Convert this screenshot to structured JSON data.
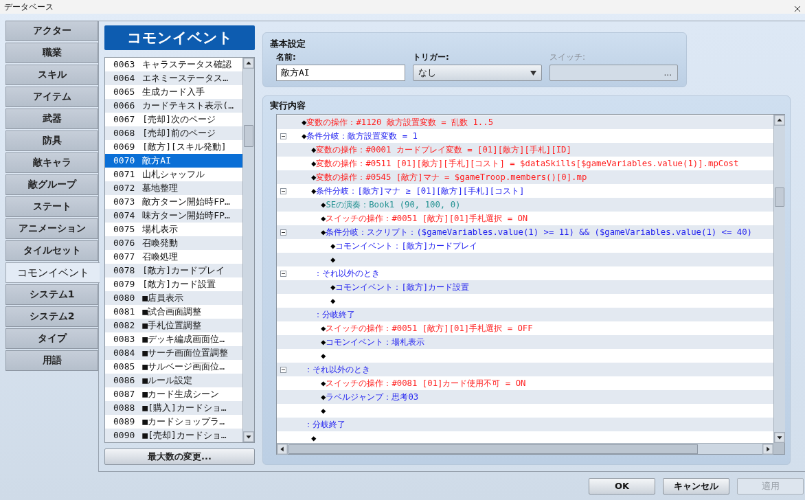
{
  "window": {
    "title": "データベース"
  },
  "tabs": [
    {
      "label": "アクター",
      "selected": false
    },
    {
      "label": "職業",
      "selected": false
    },
    {
      "label": "スキル",
      "selected": false
    },
    {
      "label": "アイテム",
      "selected": false
    },
    {
      "label": "武器",
      "selected": false
    },
    {
      "label": "防具",
      "selected": false
    },
    {
      "label": "敵キャラ",
      "selected": false
    },
    {
      "label": "敵グループ",
      "selected": false
    },
    {
      "label": "ステート",
      "selected": false
    },
    {
      "label": "アニメーション",
      "selected": false
    },
    {
      "label": "タイルセット",
      "selected": false
    },
    {
      "label": "コモンイベント",
      "selected": true
    },
    {
      "label": "システム1",
      "selected": false
    },
    {
      "label": "システム2",
      "selected": false
    },
    {
      "label": "タイプ",
      "selected": false
    },
    {
      "label": "用語",
      "selected": false
    }
  ],
  "event_list": {
    "title": "コモンイベント",
    "items": [
      {
        "number": "0063",
        "name": "キャラステータス確認",
        "selected": false
      },
      {
        "number": "0064",
        "name": "エネミーステータス…",
        "selected": false
      },
      {
        "number": "0065",
        "name": "生成カード入手",
        "selected": false
      },
      {
        "number": "0066",
        "name": "カードテキスト表示(…",
        "selected": false
      },
      {
        "number": "0067",
        "name": "[売却]次のページ",
        "selected": false
      },
      {
        "number": "0068",
        "name": "[売却]前のページ",
        "selected": false
      },
      {
        "number": "0069",
        "name": "[敵方][スキル発動]",
        "selected": false
      },
      {
        "number": "0070",
        "name": "敵方AI",
        "selected": true
      },
      {
        "number": "0071",
        "name": "山札シャッフル",
        "selected": false
      },
      {
        "number": "0072",
        "name": "墓地整理",
        "selected": false
      },
      {
        "number": "0073",
        "name": "敵方ターン開始時FP…",
        "selected": false
      },
      {
        "number": "0074",
        "name": "味方ターン開始時FP…",
        "selected": false
      },
      {
        "number": "0075",
        "name": "場札表示",
        "selected": false
      },
      {
        "number": "0076",
        "name": "召喚発動",
        "selected": false
      },
      {
        "number": "0077",
        "name": "召喚処理",
        "selected": false
      },
      {
        "number": "0078",
        "name": "[敵方]カードプレイ",
        "selected": false
      },
      {
        "number": "0079",
        "name": "[敵方]カード設置",
        "selected": false
      },
      {
        "number": "0080",
        "name": "■店員表示",
        "selected": false
      },
      {
        "number": "0081",
        "name": "■試合画面調整",
        "selected": false
      },
      {
        "number": "0082",
        "name": "■手札位置調整",
        "selected": false
      },
      {
        "number": "0083",
        "name": "■デッキ編成画面位…",
        "selected": false
      },
      {
        "number": "0084",
        "name": "■サーチ画面位置調整",
        "selected": false
      },
      {
        "number": "0085",
        "name": "■サルベージ画面位…",
        "selected": false
      },
      {
        "number": "0086",
        "name": "■ルール設定",
        "selected": false
      },
      {
        "number": "0087",
        "name": "■カード生成シーン",
        "selected": false
      },
      {
        "number": "0088",
        "name": "■[購入]カードショ…",
        "selected": false
      },
      {
        "number": "0089",
        "name": "■カードショップラ…",
        "selected": false
      },
      {
        "number": "0090",
        "name": "■[売却]カードショ…",
        "selected": false
      }
    ],
    "max_button": "最大数の変更..."
  },
  "basic_settings": {
    "title": "基本設定",
    "name_label": "名前:",
    "name_value": "敵方AI",
    "trigger_label": "トリガー:",
    "trigger_value": "なし",
    "switch_label": "スイッチ:",
    "switch_button": "...",
    "switch_disabled": true
  },
  "contents": {
    "title": "実行内容",
    "commands": [
      {
        "kind": "operation",
        "marker": "◆",
        "text": "変数の操作：#1120 敵方設置変数 = 乱数 1..5"
      },
      {
        "kind": "flow",
        "marker": "◆",
        "text": "条件分岐：敵方設置変数 = 1",
        "expanded": true,
        "children": [
          {
            "kind": "operation",
            "marker": "◆",
            "text": "変数の操作：#0001 カードプレイ変数 = [01][敵方][手札][ID]"
          },
          {
            "kind": "operation",
            "marker": "◆",
            "text": "変数の操作：#0511 [01][敵方][手札][コスト] = $dataSkills[$gameVariables.value(1)].mpCost"
          },
          {
            "kind": "operation",
            "marker": "◆",
            "text": "変数の操作：#0545 [敵方]マナ = $gameTroop.members()[0].mp"
          },
          {
            "kind": "flow",
            "marker": "◆",
            "text": "条件分岐：[敵方]マナ ≥ [01][敵方][手札][コスト]",
            "expanded": true,
            "children": [
              {
                "kind": "audio",
                "marker": "◆",
                "text": "SEの演奏：Book1 (90, 100, 0)"
              },
              {
                "kind": "operation",
                "marker": "◆",
                "text": "スイッチの操作：#0051 [敵方][01]手札選択 = ON"
              },
              {
                "kind": "flow",
                "marker": "◆",
                "text": "条件分岐：スクリプト：($gameVariables.value(1) >= 11) && ($gameVariables.value(1) <= 40)",
                "expanded": true,
                "children": [
                  {
                    "kind": "flow",
                    "marker": "◆",
                    "text": "コモンイベント：[敵方]カードプレイ"
                  },
                  {
                    "kind": "empty",
                    "marker": "◆"
                  }
                ]
              },
              {
                "kind": "branch",
                "text": "：それ以外のとき",
                "expanded": true,
                "children": [
                  {
                    "kind": "flow",
                    "marker": "◆",
                    "text": "コモンイベント：[敵方]カード設置"
                  },
                  {
                    "kind": "empty",
                    "marker": "◆"
                  }
                ]
              },
              {
                "kind": "branch",
                "text": "：分岐終了"
              },
              {
                "kind": "operation",
                "marker": "◆",
                "text": "スイッチの操作：#0051 [敵方][01]手札選択 = OFF"
              },
              {
                "kind": "flow",
                "marker": "◆",
                "text": "コモンイベント：場札表示"
              },
              {
                "kind": "empty",
                "marker": "◆"
              }
            ]
          },
          {
            "kind": "branch",
            "text": "：それ以外のとき",
            "expanded": true,
            "children": [
              {
                "kind": "operation",
                "marker": "◆",
                "text": "スイッチの操作：#0081 [01]カード使用不可 = ON"
              },
              {
                "kind": "flow",
                "marker": "◆",
                "text": "ラベルジャンプ：思考03"
              },
              {
                "kind": "empty",
                "marker": "◆"
              }
            ]
          },
          {
            "kind": "branch",
            "text": "：分岐終了"
          },
          {
            "kind": "empty",
            "marker": "◆"
          }
        ]
      }
    ]
  },
  "buttons": [
    {
      "label": "OK",
      "disabled": false
    },
    {
      "label": "キャンセル",
      "disabled": false
    },
    {
      "label": "適用",
      "disabled": true
    }
  ]
}
